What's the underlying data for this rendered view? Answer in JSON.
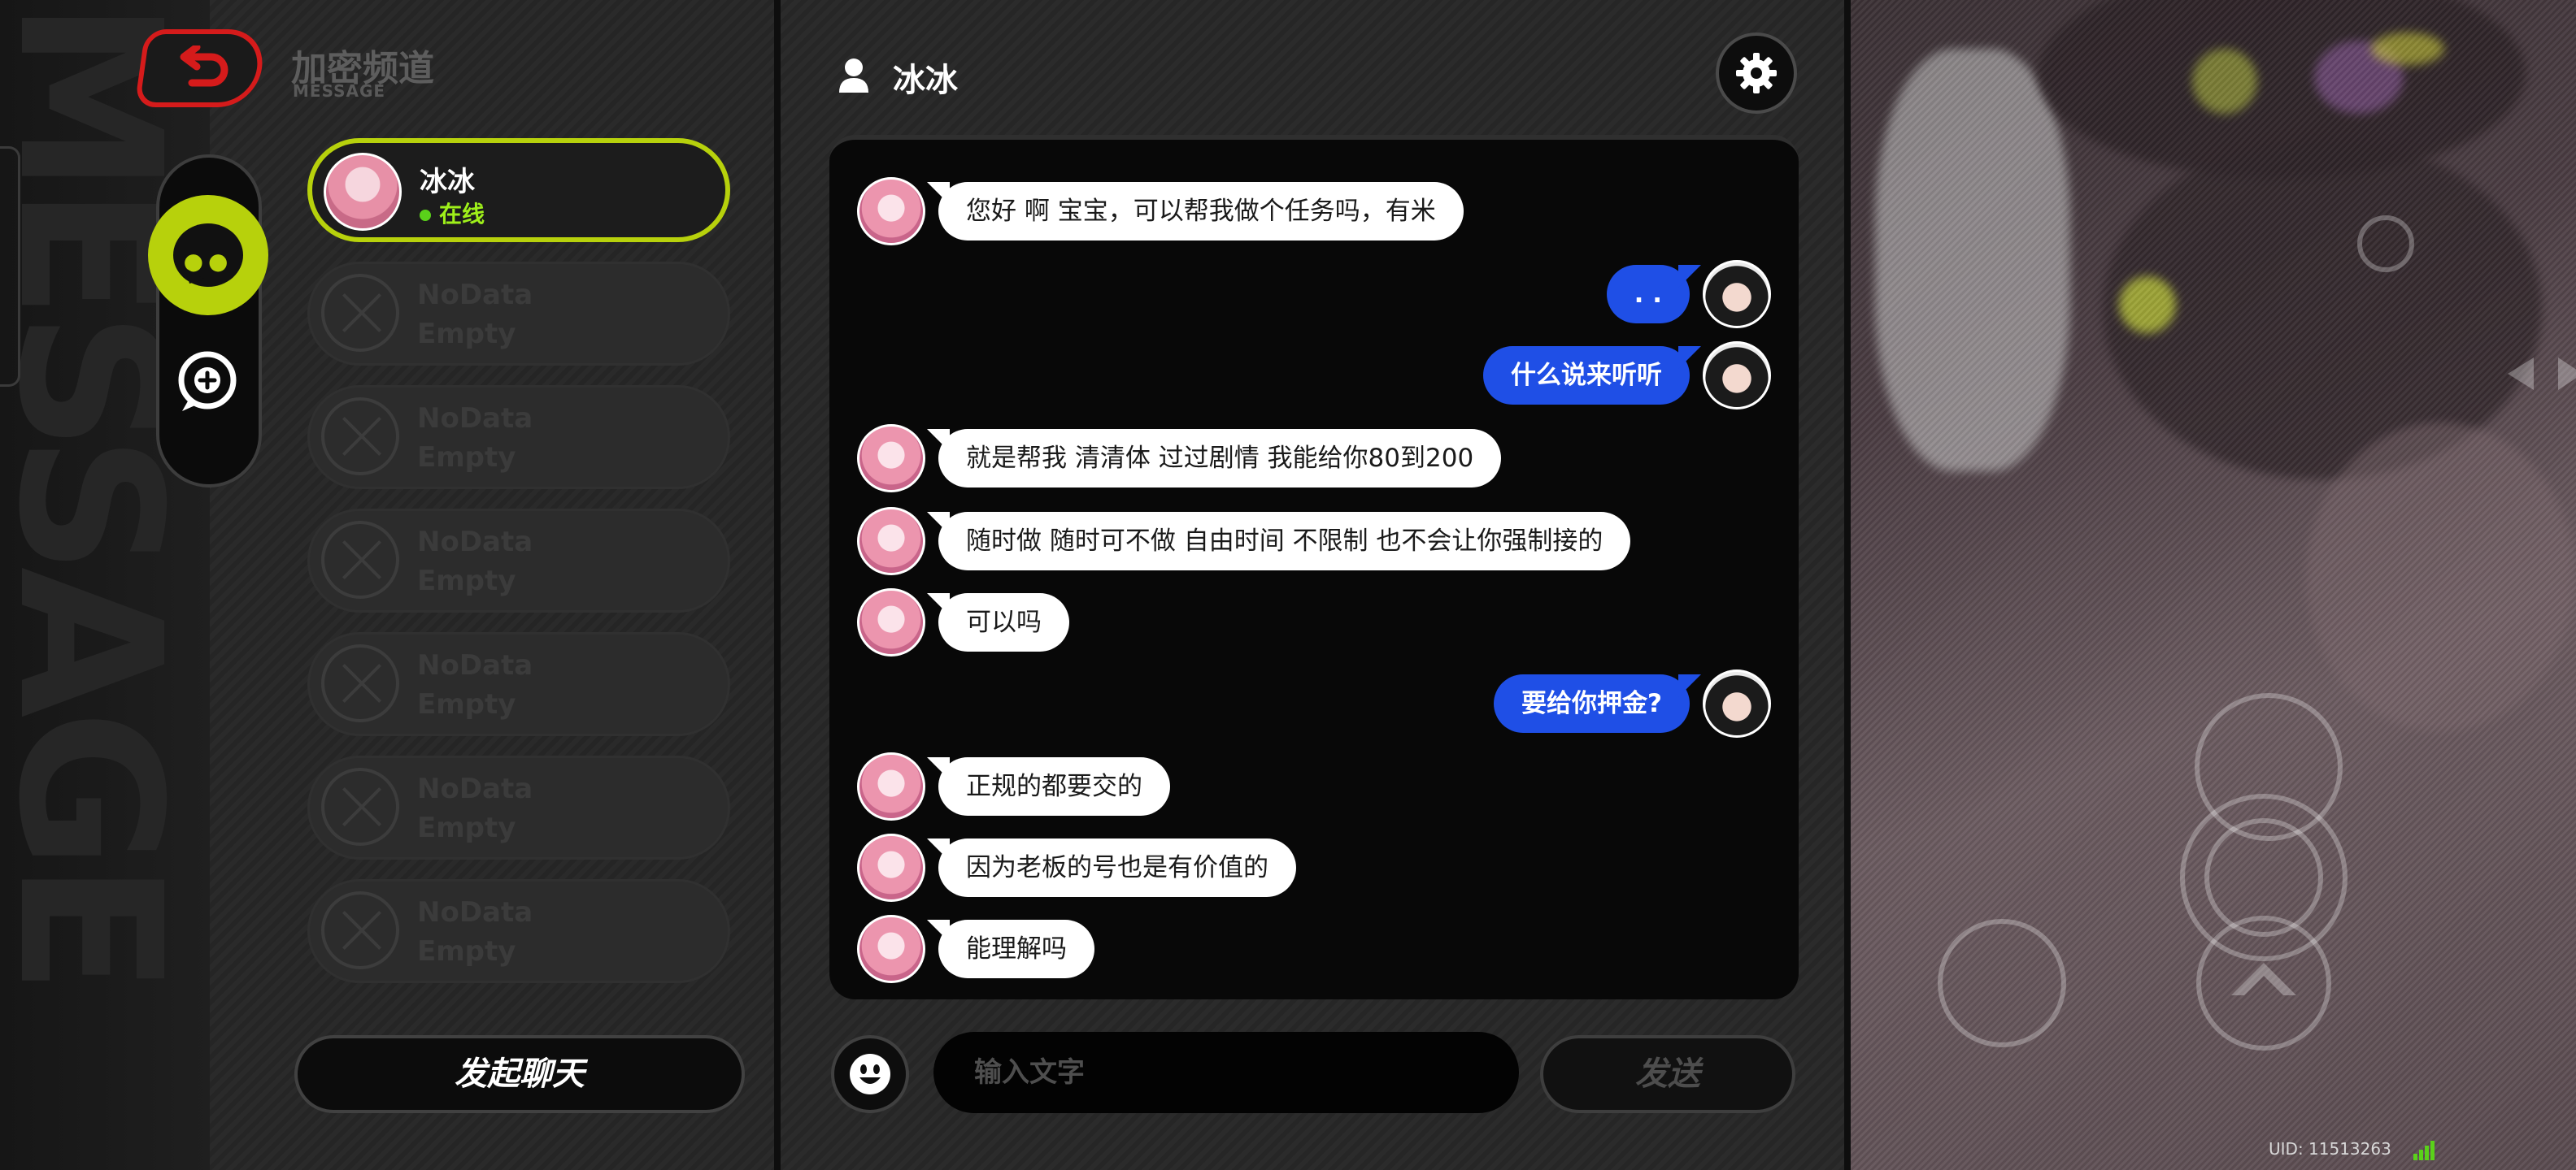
{
  "header": {
    "title": "加密频道",
    "subtitle": "MESSAGE"
  },
  "contacts": [
    {
      "name": "冰冰",
      "status": "在线",
      "active": true
    }
  ],
  "empty_slots": [
    {
      "line1": "NoData",
      "line2": "Empty"
    },
    {
      "line1": "NoData",
      "line2": "Empty"
    },
    {
      "line1": "NoData",
      "line2": "Empty"
    },
    {
      "line1": "NoData",
      "line2": "Empty"
    },
    {
      "line1": "NoData",
      "line2": "Empty"
    },
    {
      "line1": "NoData",
      "line2": "Empty"
    }
  ],
  "start_chat_label": "发起聊天",
  "chat": {
    "contact_name": "冰冰",
    "messages": [
      {
        "side": "left",
        "text": "您好 啊  宝宝，可以帮我做个任务吗，有米"
      },
      {
        "side": "right",
        "text": ". ."
      },
      {
        "side": "right",
        "text": "什么说来听听"
      },
      {
        "side": "left",
        "text": "就是帮我 清清体  过过剧情  我能给你80到200"
      },
      {
        "side": "left",
        "text": "随时做 随时可不做 自由时间 不限制 也不会让你强制接的"
      },
      {
        "side": "left",
        "text": "可以吗"
      },
      {
        "side": "right",
        "text": "要给你押金?"
      },
      {
        "side": "left",
        "text": "正规的都要交的"
      },
      {
        "side": "left",
        "text": "因为老板的号也是有价值的"
      },
      {
        "side": "left",
        "text": "能理解吗"
      }
    ]
  },
  "input": {
    "placeholder": "输入文字",
    "value": ""
  },
  "send_label": "发送",
  "uid_text": "UID: 11513263",
  "colors": {
    "accent": "#b7d10c",
    "back": "#d51b1b",
    "bubble_self": "#1f4fe6",
    "online": "#5ad11a"
  }
}
